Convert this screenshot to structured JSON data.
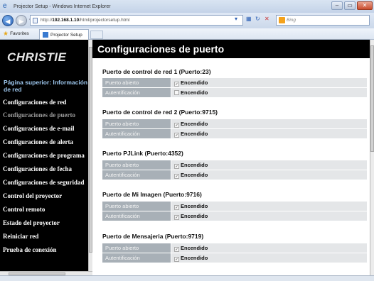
{
  "window": {
    "title": "Projector Setup - Windows Internet Explorer",
    "controls": {
      "minimize": "–",
      "maximize": "▭",
      "close": "✕"
    }
  },
  "addressbar": {
    "url_prefix": "http://",
    "url_host": "192.168.1.10",
    "url_path": "/html/projectorsetup.html",
    "search_placeholder": "Bing"
  },
  "favorites": {
    "label": "Favorites",
    "tab_title": "Projector Setup"
  },
  "sidebar": {
    "logo": "CHRISTIE",
    "home": "Página superior: Información de red",
    "items": [
      {
        "label": "Configuraciones de red"
      },
      {
        "label": "Configuraciones de puerto"
      },
      {
        "label": "Configuraciones de e-mail"
      },
      {
        "label": "Configuraciones de alerta"
      },
      {
        "label": "Configuraciones de programa"
      },
      {
        "label": "Configuraciones de fecha"
      },
      {
        "label": "Configuraciones de seguridad"
      },
      {
        "label": "Control del proyector"
      },
      {
        "label": "Control remoto"
      },
      {
        "label": "Estado del proyector"
      },
      {
        "label": "Reiniciar red"
      },
      {
        "label": "Prueba de conexión"
      }
    ]
  },
  "main": {
    "title": "Configuraciones de puerto",
    "sections": [
      {
        "title": "Puerto de control de red 1 (Puerto:23)",
        "rows": [
          {
            "label": "Puerto abierto",
            "value": "Encendido"
          },
          {
            "label": "Autentificación",
            "value": "Encendido"
          }
        ]
      },
      {
        "title": "Puerto de control de red 2 (Puerto:9715)",
        "rows": [
          {
            "label": "Puerto abierto",
            "value": "Encendido"
          },
          {
            "label": "Autentificación",
            "value": "Encendido"
          }
        ]
      },
      {
        "title": "Puerto PJLink (Puerto:4352)",
        "rows": [
          {
            "label": "Puerto abierto",
            "value": "Encendido"
          },
          {
            "label": "Autentificación",
            "value": "Encendido"
          }
        ]
      },
      {
        "title": "Puerto de Mi Imagen (Puerto:9716)",
        "rows": [
          {
            "label": "Puerto abierto",
            "value": "Encendido"
          },
          {
            "label": "Autentificación",
            "value": "Encendido"
          }
        ]
      },
      {
        "title": "Puerto de Mensajeria (Puerto:9719)",
        "rows": [
          {
            "label": "Puerto abierto",
            "value": "Encendido"
          },
          {
            "label": "Autentificación",
            "value": "Encendido"
          }
        ]
      }
    ]
  }
}
